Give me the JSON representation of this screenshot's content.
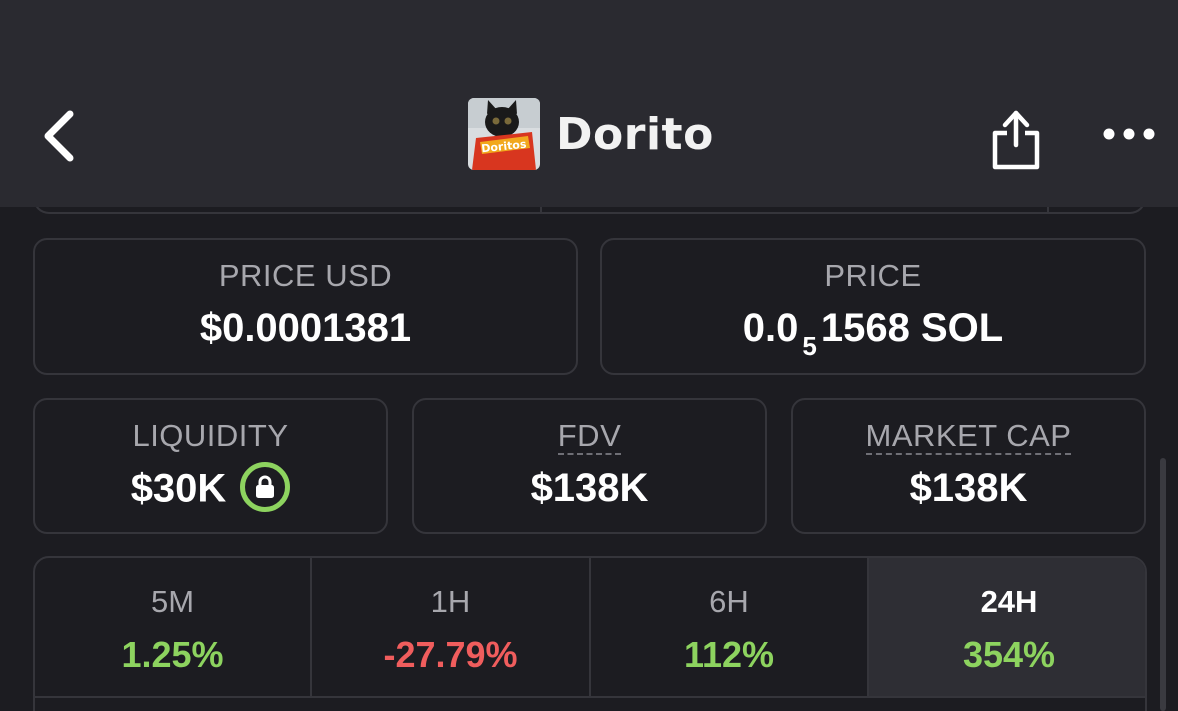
{
  "header": {
    "title": "Dorito",
    "avatar_text": "Doritos",
    "back_icon": "chevron-left-icon",
    "share_icon": "share-icon",
    "more_icon": "more-horizontal-icon"
  },
  "price_usd": {
    "label": "PRICE USD",
    "value": "$0.0001381"
  },
  "price_native": {
    "label": "PRICE",
    "prefix": "0.0",
    "subscript": "5",
    "suffix": "1568 SOL"
  },
  "stats": {
    "liquidity": {
      "label": "LIQUIDITY",
      "value": "$30K",
      "lock_icon": "lock-icon"
    },
    "fdv": {
      "label": "FDV",
      "value": "$138K"
    },
    "market_cap": {
      "label": "MARKET CAP",
      "value": "$138K"
    }
  },
  "timeframes": [
    {
      "label": "5M",
      "value": "1.25%",
      "color": "#8dd35f"
    },
    {
      "label": "1H",
      "value": "-27.79%",
      "color": "#f05d5d"
    },
    {
      "label": "6H",
      "value": "112%",
      "color": "#8dd35f"
    },
    {
      "label": "24H",
      "value": "354%",
      "color": "#8dd35f"
    }
  ],
  "colors": {
    "positive": "#8dd35f",
    "negative": "#f05d5d",
    "background": "#1c1c21",
    "header": "#2a2a30"
  }
}
